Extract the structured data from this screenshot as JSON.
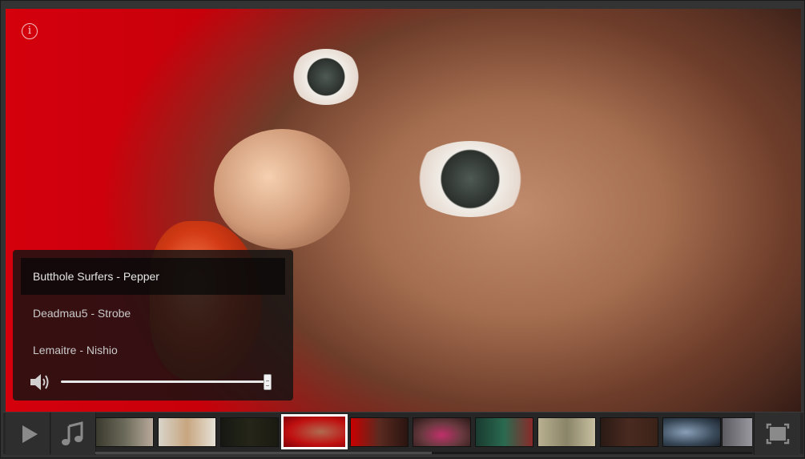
{
  "player": {
    "info_icon": "info-circle-icon",
    "colors": {
      "overlay": "#141212",
      "bar": "#262626",
      "selected_border": "#ffffff",
      "backdrop": "#d4000c"
    }
  },
  "playlist": {
    "tracks": [
      {
        "label": "Butthole Surfers - Pepper",
        "active": true
      },
      {
        "label": "Deadmau5 - Strobe",
        "active": false
      },
      {
        "label": "Lemaitre - Nishio",
        "active": false
      }
    ],
    "volume_icon": "speaker-icon",
    "volume_level": 1.0
  },
  "controls": {
    "play_icon": "play-icon",
    "music_icon": "music-note-icon",
    "fullscreen_icon": "fullscreen-icon"
  },
  "thumbnails": {
    "count": 11,
    "selected_index": 3
  }
}
